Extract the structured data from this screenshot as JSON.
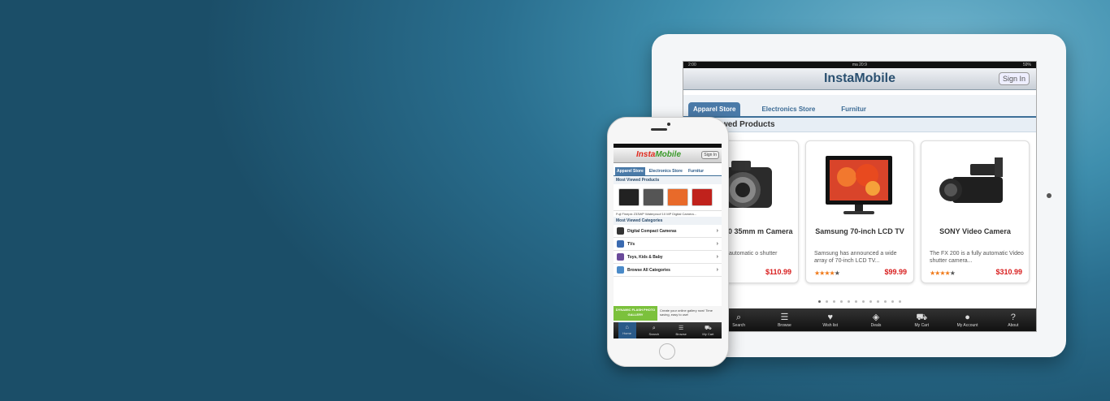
{
  "tablet": {
    "app_title": "InstaMobile",
    "sign_in": "Sign In",
    "status_left": "2:00",
    "status_center": "ma 20:9",
    "status_right": "59%",
    "tabs": [
      "Apparel Store",
      "Electronics Store",
      "Furnitur"
    ],
    "section_title": "Most Viewed Products",
    "products": [
      {
        "name": "g Fino 800 35mm m Camera",
        "desc": "00 is a fully automatic o shutter camera...",
        "price": "$110.99",
        "rating": 4
      },
      {
        "name": "Samsung 70-inch LCD TV",
        "desc": "Samsung has announced a wide array of 70-inch LCD TV...",
        "price": "$99.99",
        "rating": 4
      },
      {
        "name": "SONY Video Camera",
        "desc": "The FX 200 is a fully automatic Video shutter camera...",
        "price": "$310.99",
        "rating": 4
      }
    ],
    "tabbar": [
      {
        "label": "Search",
        "icon": "search-icon"
      },
      {
        "label": "Browse",
        "icon": "browse-icon"
      },
      {
        "label": "Wish list",
        "icon": "heart-icon"
      },
      {
        "label": "Deals",
        "icon": "tag-icon"
      },
      {
        "label": "My Cart",
        "icon": "cart-icon"
      },
      {
        "label": "My Account",
        "icon": "user-icon"
      },
      {
        "label": "About",
        "icon": "help-icon"
      }
    ]
  },
  "phone": {
    "logo_left": "Insta",
    "logo_right": "Mobile",
    "sign_in": "Sign In",
    "tabs": [
      "Apparel Store",
      "Electronics Store",
      "Furnitur"
    ],
    "most_viewed_products": "Most Viewed Products",
    "caption": "Fuji Finepix Z33WP Waterproof 10 MP Digital Camera...",
    "most_viewed_categories": "Most Viewed Categories",
    "categories": [
      "Digital Compact Cameras",
      "TVs",
      "Toys, Kids & Baby",
      "Browse All Categories"
    ],
    "banner_left": "DYNAMIC FLASH PHOTO GALLERY",
    "banner_right": "Create your online gallery now! Time saving, easy to use!",
    "tabbar": [
      {
        "label": "Home",
        "icon": "home-icon"
      },
      {
        "label": "Search",
        "icon": "search-icon"
      },
      {
        "label": "Browse",
        "icon": "browse-icon"
      },
      {
        "label": "My Cart",
        "icon": "cart-icon"
      }
    ]
  }
}
